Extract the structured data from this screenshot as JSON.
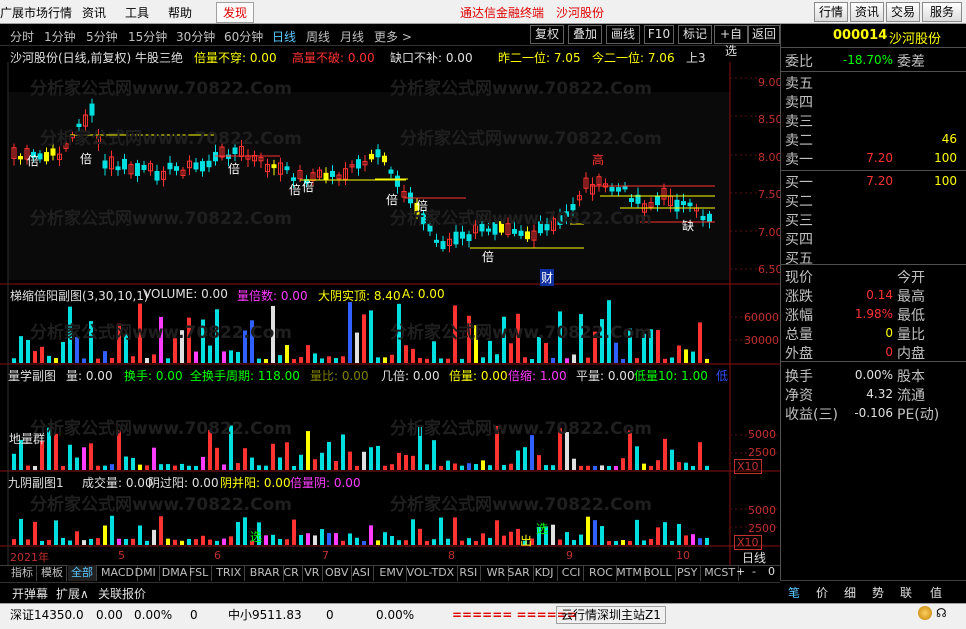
{
  "menubar": {
    "items": [
      "广展市场行情",
      "资讯",
      "工具",
      "帮助"
    ],
    "discover": "发现",
    "center_title": "通达信金融终端",
    "stock_title": "沙河股份",
    "right_buttons": [
      "行情",
      "资讯",
      "交易",
      "服务"
    ]
  },
  "toolbar": {
    "periods": [
      "分时",
      "1分钟",
      "5分钟",
      "15分钟",
      "30分钟",
      "60分钟",
      "日线",
      "周线",
      "月线",
      "更多 >"
    ],
    "active": "日线",
    "buttons": [
      "复权",
      "叠加",
      "画线",
      "F10",
      "标记",
      "+自选",
      "返回"
    ]
  },
  "main_chart": {
    "header": {
      "name": "沙河股份(日线,前复权) 牛股三绝",
      "f1": "倍量不穿: 0.00",
      "f2": "高量不破: 0.00",
      "f3": "缺口不补: 0.00",
      "f4": "昨二一位: 7.05",
      "f5": "今二一位: 7.06",
      "f6": "上3"
    },
    "y_ticks": [
      "9.00",
      "8.50",
      "8.00",
      "7.50",
      "7.00",
      "6.50"
    ],
    "labels": [
      "倍",
      "倍",
      "倍",
      "倍",
      "倍",
      "倍",
      "倍",
      "倍",
      "高",
      "缺",
      "财"
    ],
    "colors": {
      "up": "#ff3232",
      "down": "#00e0e0",
      "yellow": "#ffff00"
    }
  },
  "sub1": {
    "header": {
      "name": "梯缩倍阳副图(3,30,10,1)",
      "f1": "VOLUME: 0.00",
      "f2": "量倍数: 0.00",
      "f3": "大阴实顶: 8.40",
      "f4": "A: 0.00"
    },
    "y_ticks": [
      "60000",
      "30000"
    ]
  },
  "sub2": {
    "header": {
      "name": "量学副图",
      "f1": "量: 0.00",
      "f2": "换手: 0.00",
      "f3": "全换手周期: 118.00",
      "f4": "量比: 0.00",
      "f5": "几倍: 0.00",
      "f6": "倍量: 0.00",
      "f7": "倍缩: 1.00",
      "f8": "平量: 0.00",
      "f9": "低量10: 1.00",
      "f10": "低"
    },
    "note": "地量群",
    "y_ticks": [
      "5000",
      "2500"
    ],
    "x10": "X10"
  },
  "sub3": {
    "header": {
      "name": "九阴副图1",
      "f1": "成交量: 0.00",
      "f2": "阴过阳: 0.00",
      "f3": "阴并阳: 0.00",
      "f4": "倍量阴: 0.00"
    },
    "marks": [
      "选",
      "出",
      "选"
    ],
    "y_ticks": [
      "5000",
      "2500"
    ],
    "x10": "X10"
  },
  "xaxis": {
    "labels": [
      "2021年",
      "5",
      "6",
      "7",
      "8",
      "9",
      "10"
    ],
    "period": "日线"
  },
  "tabs": {
    "indicator_tabs": [
      "指标",
      "模板",
      "全部",
      "MACD",
      "DMI",
      "DMA",
      "FSL",
      "TRIX",
      "BRAR",
      "CR",
      "VR",
      "OBV",
      "ASI",
      "EMV",
      "VOL-TDX",
      "RSI",
      "WR",
      "SAR",
      "KDJ",
      "CCI",
      "ROC",
      "MTM",
      "BOLL",
      "PSY",
      "MCST"
    ],
    "active": "全部",
    "row2": [
      "开弹幕",
      "扩展∧",
      "关联报价"
    ],
    "nav_buttons": [
      "+",
      "-",
      "0"
    ]
  },
  "right_panel": {
    "code": "000014",
    "name": "沙河股份",
    "weibi_label": "委比",
    "weibi_value": "-18.70%",
    "weicha_label": "委差",
    "sell_labels": [
      "卖五",
      "卖四",
      "卖三",
      "卖二",
      "卖一"
    ],
    "sell_prices": [
      "",
      "",
      "",
      "",
      "7.20"
    ],
    "sell_vols": [
      "",
      "",
      "",
      "46",
      "100"
    ],
    "buy_labels": [
      "买一",
      "买二",
      "买三",
      "买四",
      "买五"
    ],
    "buy_prices": [
      "7.20",
      "",
      "",
      "",
      ""
    ],
    "buy_vols": [
      "100",
      "",
      "",
      "",
      ""
    ],
    "stats": [
      {
        "l": "现价",
        "v": "",
        "r": "今开"
      },
      {
        "l": "涨跌",
        "v": "0.14",
        "r": "最高"
      },
      {
        "l": "涨幅",
        "v": "1.98%",
        "r": "最低"
      },
      {
        "l": "总量",
        "v": "0",
        "r": "量比"
      },
      {
        "l": "外盘",
        "v": "0",
        "r": "内盘"
      },
      {
        "l": "换手",
        "v": "0.00%",
        "r": "股本"
      },
      {
        "l": "净资",
        "v": "4.32",
        "r": "流通"
      },
      {
        "l": "收益(三)",
        "v": "-0.106",
        "r": "PE(动)"
      }
    ],
    "bottom_tabs": [
      "笔",
      "价",
      "细",
      "势",
      "联",
      "值"
    ]
  },
  "statusbar": {
    "sz": "深证14350.0",
    "sz_chg": "0.00",
    "sz_pct": "0.00%",
    "sz_vol": "0",
    "zx": "中小9511.83",
    "zx_chg": "0",
    "zx_pct": "0.00%",
    "signal": "====== ======",
    "site": "云行情深圳主站Z1"
  },
  "watermark": "分析家公式网www.70822.Com"
}
